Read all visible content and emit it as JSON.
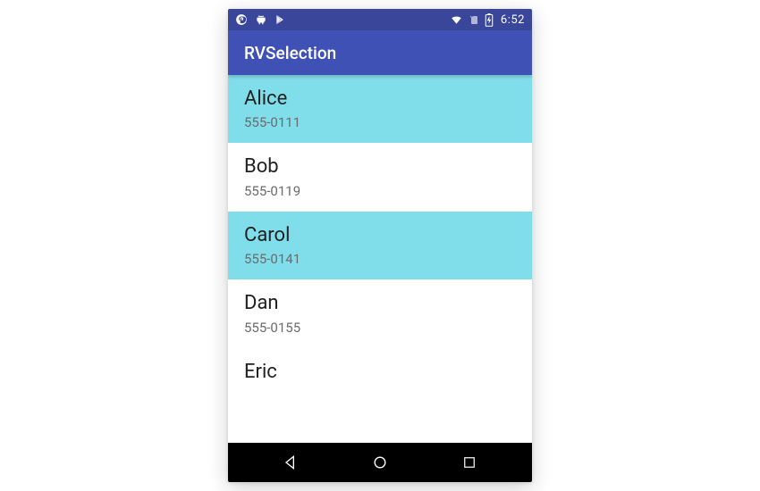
{
  "status_bar": {
    "time": "6:52"
  },
  "app_bar": {
    "title": "RVSelection"
  },
  "colors": {
    "status_bar": "#3a4699",
    "app_bar": "#3f51b5",
    "selected_bg": "#80deea"
  },
  "contacts": [
    {
      "name": "Alice",
      "phone": "555-0111",
      "selected": true
    },
    {
      "name": "Bob",
      "phone": "555-0119",
      "selected": false
    },
    {
      "name": "Carol",
      "phone": "555-0141",
      "selected": true
    },
    {
      "name": "Dan",
      "phone": "555-0155",
      "selected": false
    },
    {
      "name": "Eric",
      "phone": "",
      "selected": false
    }
  ]
}
